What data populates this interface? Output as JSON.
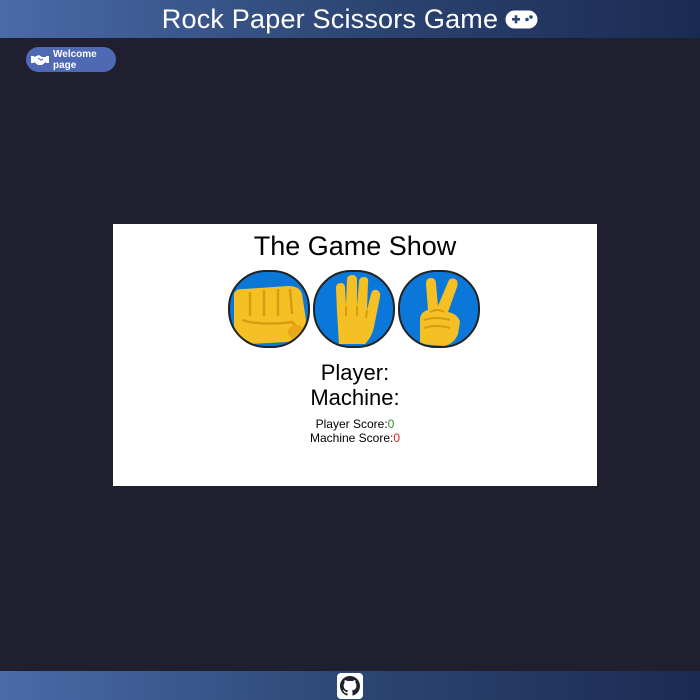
{
  "header": {
    "title": "Rock Paper Scissors Game",
    "icon": "gamepad-icon"
  },
  "welcome_button": {
    "label": "Welcome page",
    "icon": "handshake-icon"
  },
  "game": {
    "title": "The Game Show",
    "choices": [
      {
        "name": "rock",
        "icon": "fist-icon"
      },
      {
        "name": "paper",
        "icon": "raised-hand-icon"
      },
      {
        "name": "scissors",
        "icon": "victory-hand-icon"
      }
    ],
    "player_label": "Player:",
    "machine_label": "Machine:",
    "player_score_label": "Player Score:",
    "player_score": "0",
    "machine_score_label": "Machine Score:",
    "machine_score": "0"
  },
  "footer": {
    "icon": "github-icon"
  },
  "colors": {
    "background": "#1f1f2f",
    "header_gradient_start": "#4a6aa8",
    "header_gradient_end": "#1b2a52",
    "button_bg": "#4f69b5",
    "choice_bg": "#0b78d9",
    "player_score_color": "#2e8b2e",
    "machine_score_color": "#d42020"
  }
}
